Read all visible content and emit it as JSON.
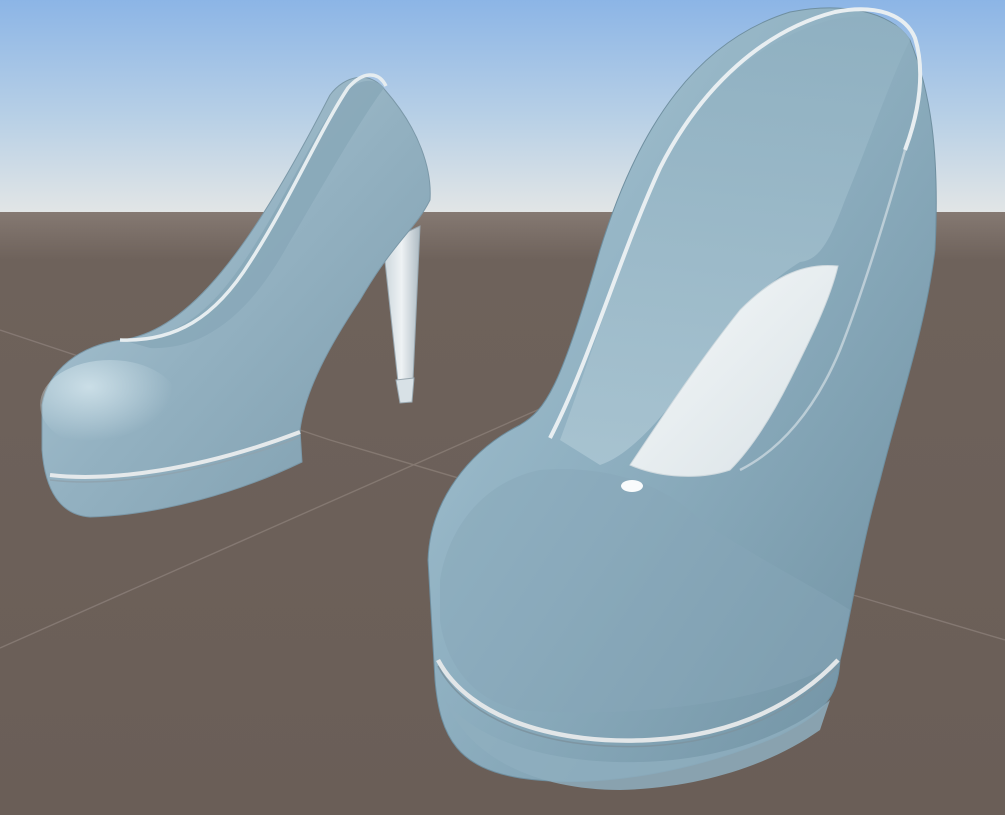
{
  "scene": {
    "sky_top_color": "#8fb7e6",
    "sky_horizon_color": "#dde6ea",
    "ground_color": "#6b5f58",
    "grid_line_color": "#877b75",
    "shoe_base_color": "#9fbccb",
    "shoe_shadow_color": "#6f8d9c",
    "shoe_highlight_color": "#cfe3ec",
    "trim_color": "#e4e8ea",
    "insole_color": "#eef3f5",
    "objects": [
      {
        "name": "left-shoe",
        "kind": "high-heel pump"
      },
      {
        "name": "right-shoe",
        "kind": "high-heel pump"
      }
    ]
  }
}
